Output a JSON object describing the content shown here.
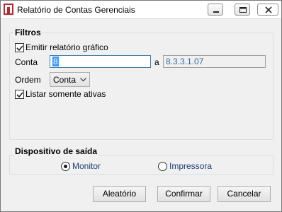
{
  "window": {
    "title": "Relatório de Contas Gerenciais"
  },
  "filters": {
    "group_label": "Filtros",
    "emit_graphic": {
      "label": "Emitir relatório gráfico",
      "checked": true
    },
    "conta": {
      "label": "Conta",
      "from_value": "8",
      "separator": "a",
      "to_value": "8.3.3.1.07"
    },
    "ordem": {
      "label": "Ordem",
      "selected": "Conta"
    },
    "only_active": {
      "label": "Listar somente ativas",
      "checked": true
    }
  },
  "output_device": {
    "group_label": "Dispositivo de saída",
    "options": [
      {
        "label": "Monitor",
        "selected": true
      },
      {
        "label": "Impressora",
        "selected": false
      }
    ]
  },
  "buttons": {
    "random": "Aleatório",
    "confirm": "Confirmar",
    "cancel": "Cancelar"
  },
  "icons": {
    "app": "app-report-icon",
    "minimize": "minimize-icon",
    "maximize": "maximize-icon",
    "close": "close-icon"
  }
}
